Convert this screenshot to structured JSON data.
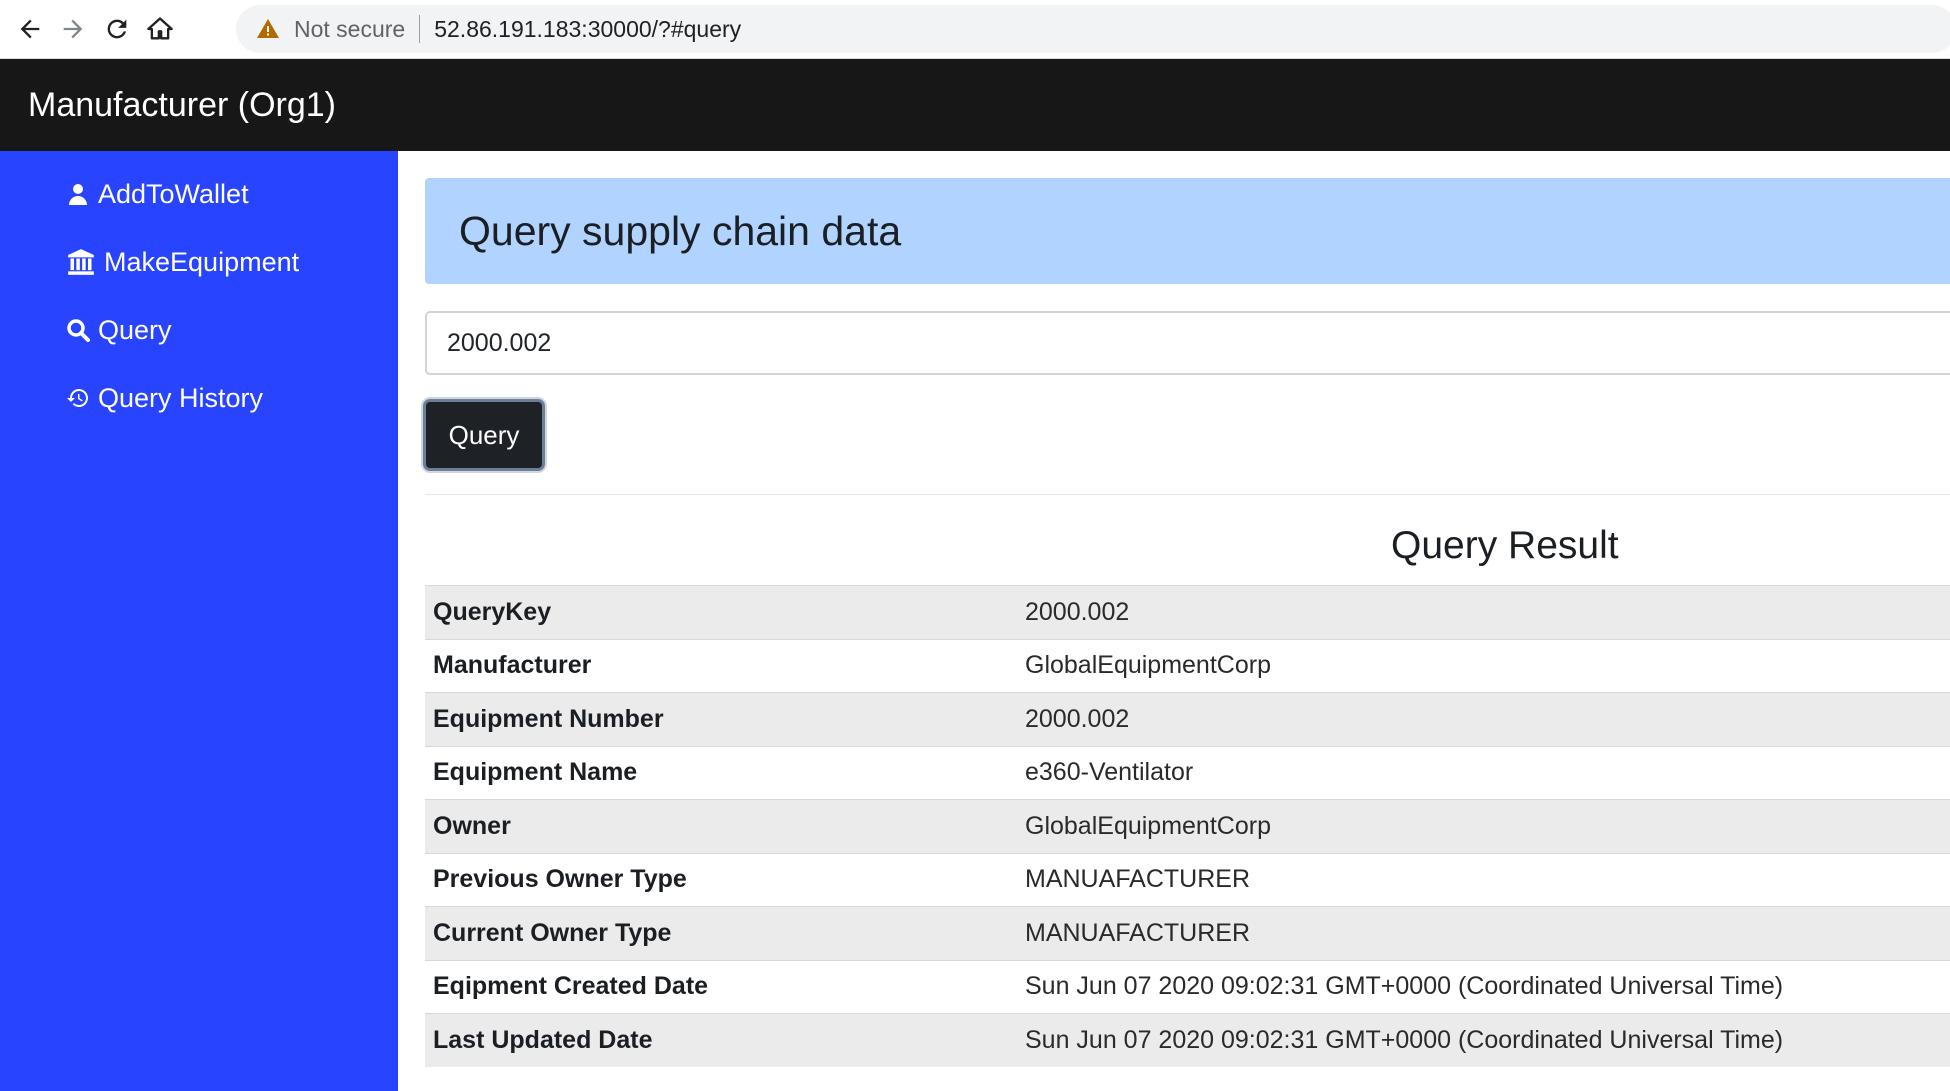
{
  "browser": {
    "security_label": "Not secure",
    "url": "52.86.191.183:30000/?#query"
  },
  "app": {
    "brand": "Manufacturer (Org1)"
  },
  "sidebar": {
    "items": [
      {
        "label": "AddToWallet",
        "icon": "user-icon"
      },
      {
        "label": "MakeEquipment",
        "icon": "bank-icon"
      },
      {
        "label": "Query",
        "icon": "search-icon"
      },
      {
        "label": "Query History",
        "icon": "history-icon"
      }
    ]
  },
  "main": {
    "header": "Query supply chain data",
    "input_value": "2000.002",
    "query_button": "Query",
    "result_title": "Query Result",
    "rows": [
      {
        "key": "QueryKey",
        "value": "2000.002"
      },
      {
        "key": "Manufacturer",
        "value": "GlobalEquipmentCorp"
      },
      {
        "key": "Equipment Number",
        "value": "2000.002"
      },
      {
        "key": "Equipment Name",
        "value": "e360-Ventilator"
      },
      {
        "key": "Owner",
        "value": "GlobalEquipmentCorp"
      },
      {
        "key": "Previous Owner Type",
        "value": "MANUAFACTURER"
      },
      {
        "key": "Current Owner Type",
        "value": "MANUAFACTURER"
      },
      {
        "key": "Eqipment Created Date",
        "value": "Sun Jun 07 2020 09:02:31 GMT+0000 (Coordinated Universal Time)"
      },
      {
        "key": "Last Updated Date",
        "value": "Sun Jun 07 2020 09:02:31 GMT+0000 (Coordinated Universal Time)"
      }
    ]
  },
  "colors": {
    "navbar": "#171717",
    "sidebar": "#2844ff",
    "header_bg": "#b0d3ff",
    "button": "#1e2125"
  }
}
